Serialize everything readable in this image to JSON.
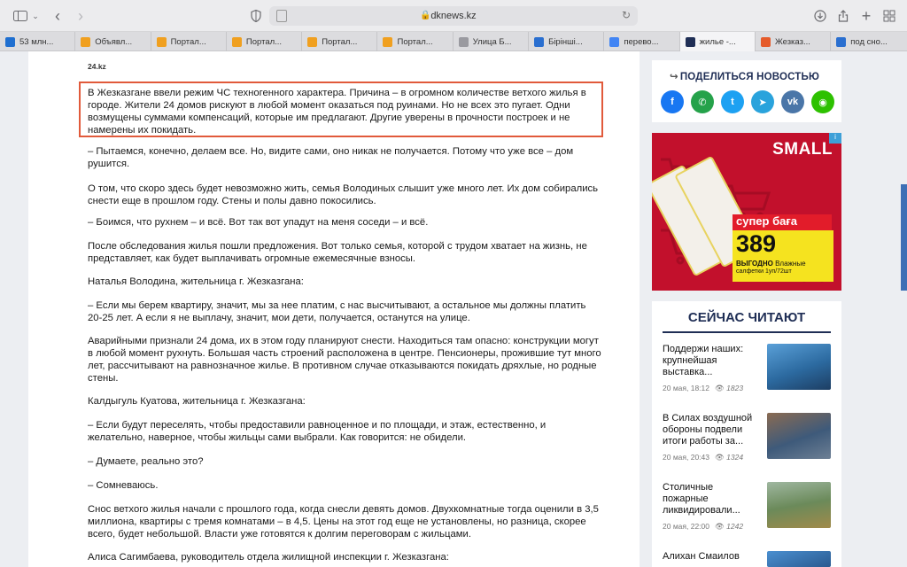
{
  "browser": {
    "url": "dknews.kz",
    "tabs": [
      {
        "label": "53 млн...",
        "fav": "#1f6fd0"
      },
      {
        "label": "Объявл...",
        "fav": "#f0a020"
      },
      {
        "label": "Портал...",
        "fav": "#f0a020"
      },
      {
        "label": "Портал...",
        "fav": "#f0a020"
      },
      {
        "label": "Портал...",
        "fav": "#f0a020"
      },
      {
        "label": "Портал...",
        "fav": "#f0a020"
      },
      {
        "label": "Улица Б...",
        "fav": "#9a9aa0"
      },
      {
        "label": "Бірінші...",
        "fav": "#2a6fd0"
      },
      {
        "label": "перево...",
        "fav": "#4285f4"
      },
      {
        "label": "жилье -...",
        "fav": "#1f2e55"
      },
      {
        "label": "Жезказ...",
        "fav": "#e55b2b"
      },
      {
        "label": "под сно...",
        "fav": "#2a6fd0"
      }
    ]
  },
  "article": {
    "site": "24.kz",
    "lead": "В Жезказгане ввели режим ЧС техногенного характера. Причина – в огромном количестве ветхого жилья в городе. Жители 24 домов рискуют в любой момент оказаться под руинами. Но не всех это пугает. Одни возмущены суммами компенсаций, которые им предлагают. Другие уверены в прочности построек и не намерены их покидать.",
    "p1": "– Пытаемся, конечно, делаем все. Но, видите сами, оно никак не получается. Потому что уже все – дом рушится.",
    "p2": "О том, что скоро здесь будет невозможно жить, семья Володиных слышит уже много лет. Их дом собирались снести еще в прошлом году. Стены и полы давно покосились.",
    "p3": "– Боимся, что рухнем – и всё. Вот так вот упадут на меня соседи – и всё.",
    "p4": "После обследования жилья пошли предложения. Вот только семья, которой с трудом хватает на жизнь, не представляет, как будет выплачивать огромные ежемесячные взносы.",
    "p5": "Наталья Володина, жительница г. Жезказгана:",
    "p6": "– Если мы берем квартиру, значит, мы за нее платим, с нас высчитывают, а остальное мы должны платить 20-25 лет. А если я не выплачу, значит, мои дети, получается, останутся на улице.",
    "p7": "Аварийными признали 24 дома, их в этом году планируют снести. Находиться там опасно: конструкции могут в любой момент рухнуть. Большая часть строений расположена в центре. Пенсионеры, прожившие тут много лет, рассчитывают на равнозначное жилье. В противном случае отказываются покидать дряхлые, но родные стены.",
    "p8": "Калдыгуль Куатова, жительница г. Жезказгана:",
    "p9": "– Если будут переселять, чтобы предоставили равноценное и по площади, и этаж, естественно, и желательно, наверное, чтобы жильцы сами выбрали. Как говорится: не обидели.",
    "p10": "– Думаете, реально это?",
    "p11": "– Сомневаюсь.",
    "p12": "Снос ветхого жилья начали с прошлого года, когда снесли девять домов. Двухкомнатные тогда оценили в 3,5 миллиона, квартиры с тремя комнатами – в 4,5. Цены на этот год еще не установлены, но разница, скорее всего, будет небольшой. Власти уже готовятся к долгим переговорам с жильцами.",
    "p13": "Алиса Сагимбаева, руководитель отдела жилищной инспекции г. Жезказгана:"
  },
  "share": {
    "title": "ПОДЕЛИТЬСЯ НОВОСТЬЮ",
    "buttons": [
      {
        "name": "facebook",
        "glyph": "f",
        "color": "#1877f2"
      },
      {
        "name": "whatsapp",
        "glyph": "✆",
        "color": "#25a24a"
      },
      {
        "name": "twitter",
        "glyph": "t",
        "color": "#1da1f2"
      },
      {
        "name": "telegram",
        "glyph": "➤",
        "color": "#2aa3dc"
      },
      {
        "name": "vk",
        "glyph": "vk",
        "color": "#4a76a8"
      },
      {
        "name": "wechat",
        "glyph": "◉",
        "color": "#2dc100"
      }
    ]
  },
  "ad": {
    "brand": "SMALL",
    "promo": "супер баға",
    "price": "389",
    "word": "ВЫГОДНО",
    "desc_a": "Влажные",
    "desc_b": "салфетки 1уп/72шт"
  },
  "reading": {
    "title": "СЕЙЧАС ЧИТАЮТ",
    "items": [
      {
        "title": "Поддержи наших: крупнейшая выставка...",
        "date": "20 мая, 18:12",
        "views": "1823"
      },
      {
        "title": "В Силах воздушной обороны подвели итоги работы за...",
        "date": "20 мая, 20:43",
        "views": "1324"
      },
      {
        "title": "Столичные пожарные ликвидировали...",
        "date": "20 мая, 22:00",
        "views": "1242"
      },
      {
        "title": "Алихан Смаилов",
        "date": "",
        "views": ""
      }
    ]
  }
}
